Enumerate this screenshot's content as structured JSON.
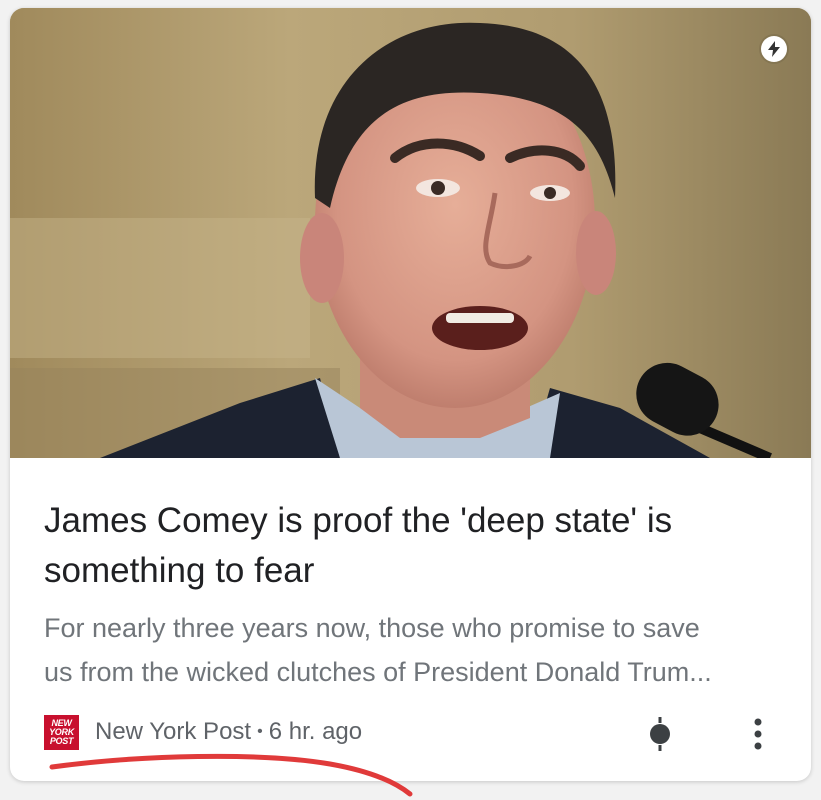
{
  "card": {
    "headline": "James Comey is proof the 'deep state' is something to fear",
    "snippet_line1": "For nearly three years now, those who promise to save",
    "snippet_line2": "us from the wicked clutches of President Donald Trum...",
    "source": "New York Post",
    "separator": "•",
    "time_ago": "6 hr. ago",
    "logo_text": [
      "NEW",
      "YORK",
      "POST"
    ],
    "badge_icon": "amp-lightning-icon",
    "actions": [
      "bubble-menu-icon",
      "more-vert-icon"
    ]
  },
  "colors": {
    "headline": "#202124",
    "snippet": "#70757a",
    "meta": "#5f6368",
    "logo_bg": "#c8102e",
    "annotation_stroke": "#e03a3a"
  }
}
